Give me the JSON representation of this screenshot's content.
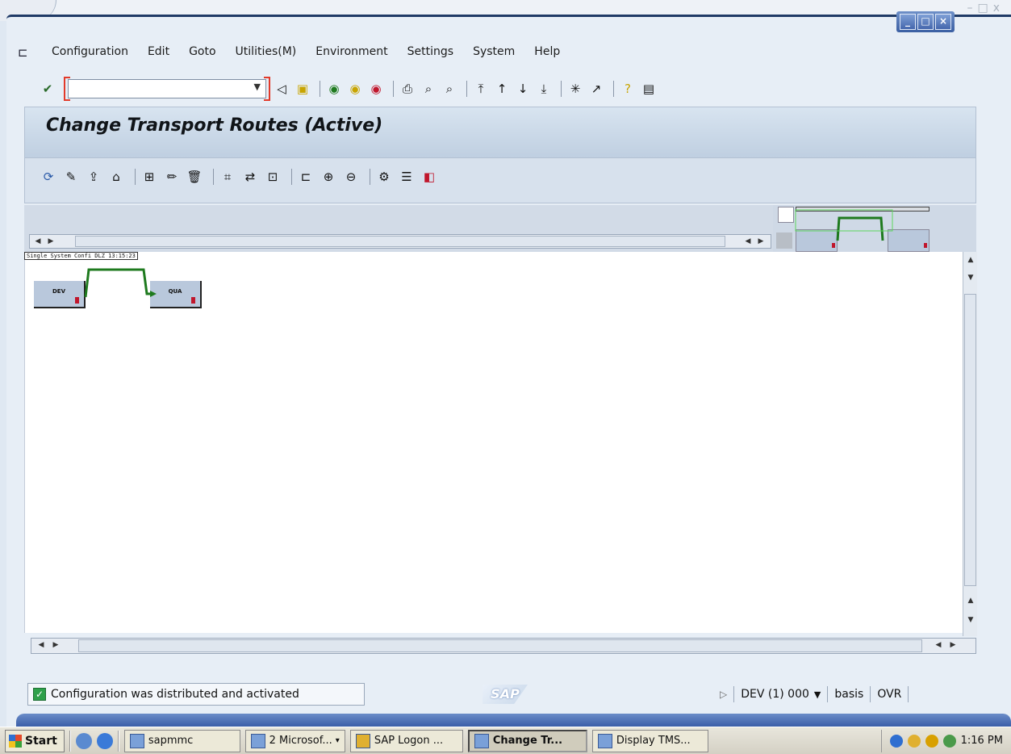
{
  "menubar": {
    "items": [
      {
        "label": "Configuration"
      },
      {
        "label": "Edit"
      },
      {
        "label": "Goto"
      },
      {
        "label": "Utilities(M)"
      },
      {
        "label": "Environment"
      },
      {
        "label": "Settings"
      },
      {
        "label": "System"
      },
      {
        "label": "Help"
      }
    ]
  },
  "toolbar": {
    "command_field": {
      "value": "",
      "placeholder": ""
    }
  },
  "page": {
    "title": "Change Transport Routes (Active)"
  },
  "graph": {
    "caption": "Single System Confi DLZ  13:15:23",
    "nodes": [
      {
        "label": "DEV"
      },
      {
        "label": "QUA"
      }
    ]
  },
  "status": {
    "message": "Configuration was distributed and activated",
    "logo": "SAP",
    "system": "DEV (1) 000",
    "user": "basis",
    "mode": "OVR"
  },
  "taskbar": {
    "start_label": "Start",
    "tasks": [
      {
        "label": "sapmmc"
      },
      {
        "label": "2 Microsof..."
      },
      {
        "label": "SAP Logon ..."
      },
      {
        "label": "Change Tr..."
      },
      {
        "label": "Display TMS..."
      }
    ],
    "clock": "1:16 PM"
  },
  "colors": {
    "route_line": "#1e7a1e",
    "node_fill": "#b9c8dc",
    "frame": "#1f3a66"
  }
}
